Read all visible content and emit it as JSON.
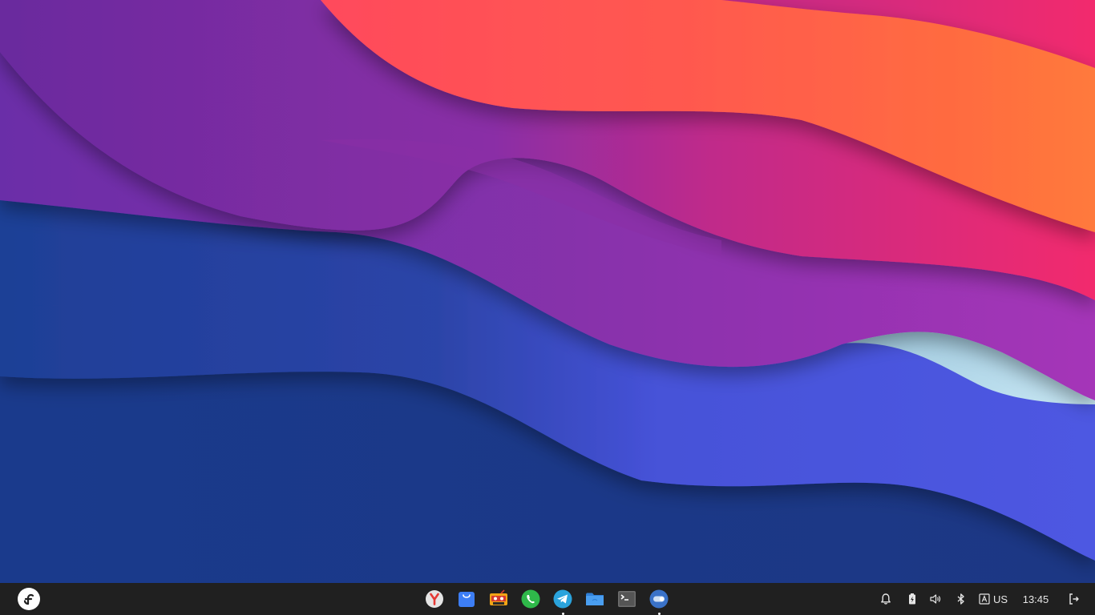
{
  "desktop": {
    "wallpaper_name": "wave-gradient-wallpaper",
    "colors": {
      "deep_blue": "#1b3a8a",
      "indigo": "#4b57e0",
      "purple": "#8a2fa8",
      "violet": "#6c2a9c",
      "pink": "#f2296d",
      "coral": "#ff4c5a",
      "orange": "#ff6b3d",
      "light_orange": "#ffa35a",
      "ice": "#bfe2f0"
    }
  },
  "taskbar": {
    "background": "#202020",
    "launcher": {
      "icon": "fedora-icon"
    },
    "dock": [
      {
        "name": "yandex-browser",
        "icon": "yandex-browser-icon",
        "running": false
      },
      {
        "name": "software-store",
        "icon": "shopping-bag-icon",
        "running": false
      },
      {
        "name": "cassette-player",
        "icon": "cassette-icon",
        "running": false
      },
      {
        "name": "whatsapp",
        "icon": "whatsapp-icon",
        "running": false
      },
      {
        "name": "telegram",
        "icon": "telegram-icon",
        "running": true
      },
      {
        "name": "file-manager",
        "icon": "folder-icon",
        "running": false
      },
      {
        "name": "terminal",
        "icon": "terminal-icon",
        "running": false
      },
      {
        "name": "settings-toggle",
        "icon": "toggle-icon",
        "running": true
      }
    ],
    "tray": {
      "notifications_icon": "bell-icon",
      "battery_icon": "battery-charging-icon",
      "volume_icon": "volume-icon",
      "bluetooth_icon": "bluetooth-icon",
      "keyboard_icon": "keyboard-layout-icon",
      "keyboard_layout": "US",
      "clock": "13:45",
      "power_icon": "logout-icon"
    }
  }
}
